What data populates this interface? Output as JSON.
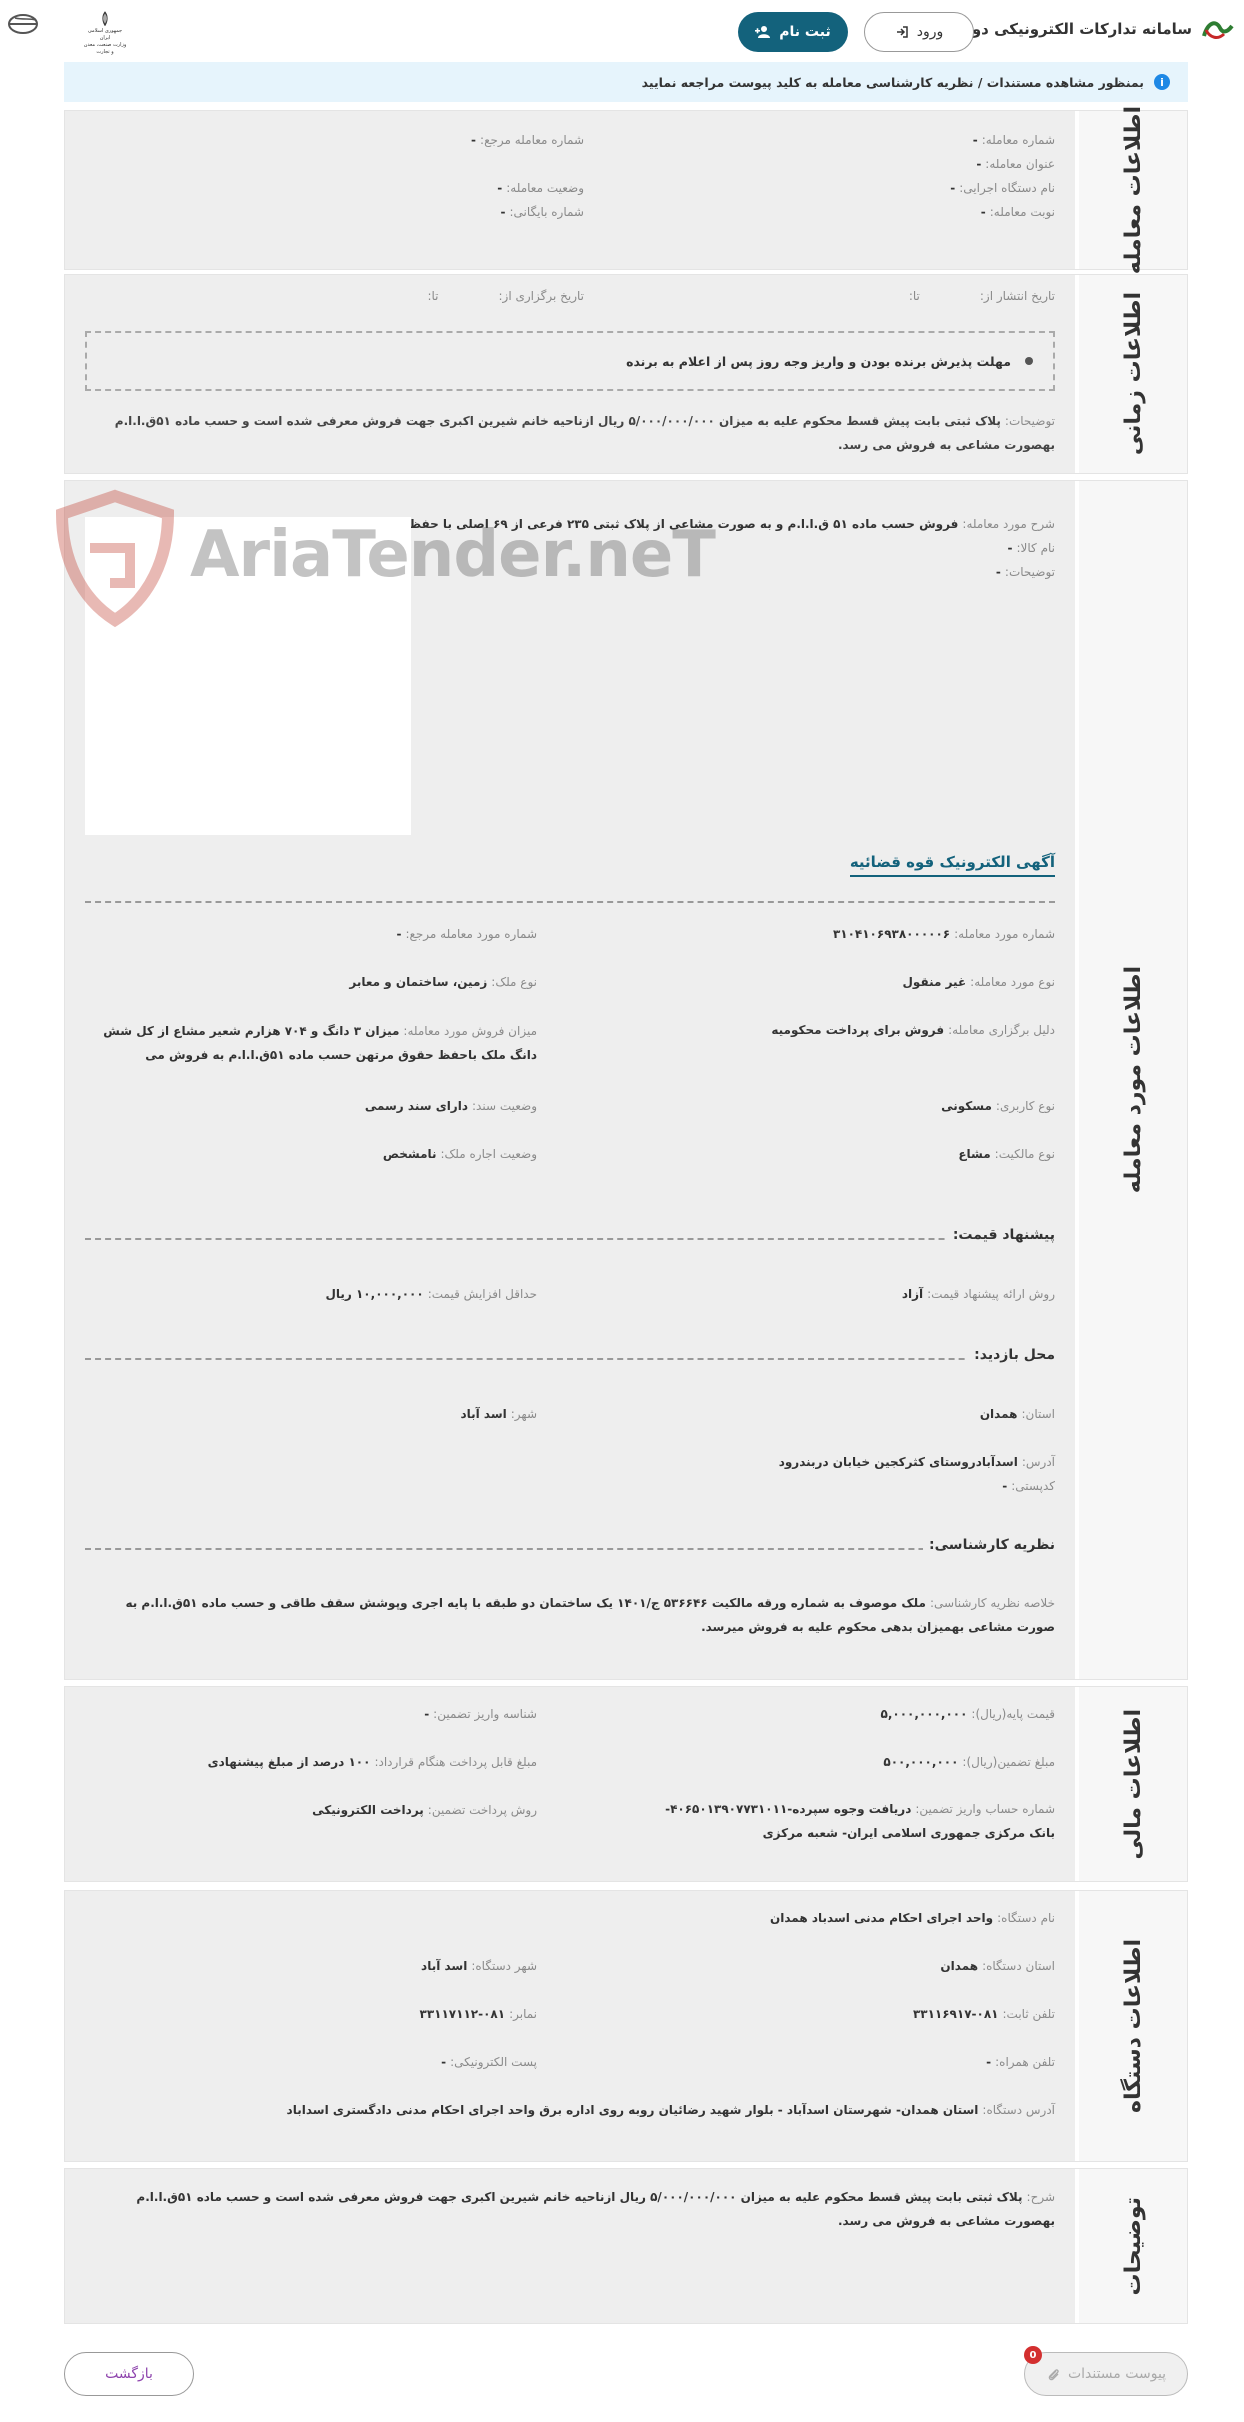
{
  "header": {
    "title": "سامانه تدارکات الکترونیکی دولت",
    "register_label": "ثبت نام",
    "login_label": "ورود",
    "gov_logo_text": "وزارت صنعت، معدن و تجارت",
    "gov_logo_subtext": "جمهوری اسلامی ایران"
  },
  "info_bar": {
    "text": "بمنظور مشاهده مستندات / نظریه کارشناسی معامله به کلید پیوست مراجعه نمایید"
  },
  "watermark": "AriaTender.neT",
  "deal_info": {
    "section_title": "اطلاعات معامله",
    "deal_number": {
      "label": "شماره معامله:",
      "value": "-"
    },
    "deal_title": {
      "label": "عنوان معامله:",
      "value": "-"
    },
    "agency_name": {
      "label": "نام دستگاه اجرایی:",
      "value": "-"
    },
    "deal_turn": {
      "label": "نوبت معامله:",
      "value": "-"
    },
    "ref_number": {
      "label": "شماره معامله مرجع:",
      "value": "-"
    },
    "deal_status": {
      "label": "وضعیت معامله:",
      "value": "-"
    },
    "archive_number": {
      "label": "شماره بایگانی:",
      "value": "-"
    }
  },
  "time_info": {
    "section_title": "اطلاعات زمانی",
    "publish_date": {
      "label": "تاریخ انتشار از:",
      "to": "تا:"
    },
    "hold_date": {
      "label": "تاریخ برگزاری از:",
      "to": "تا:"
    },
    "deadline": "مهلت پذیرش برنده بودن و واریز وجه روز پس از اعلام به برنده",
    "description": {
      "label": "توضیحات:",
      "value": "پلاک ثبتی بابت پیش قسط محکوم علیه به میزان ۵/۰۰۰/۰۰۰/۰۰۰ ریال ازناحیه خانم شیرین اکبری جهت فروش معرفی شده است و حسب ماده ۵۱ق.ا.ا.م بهصورت مشاعی به فروش می رسد."
    }
  },
  "item_info": {
    "section_title": "اطلاعات مورد معامله",
    "item_desc": {
      "label": "شرح مورد معامله:",
      "value": "فروش حسب ماده ۵۱ ق.ا.ا.م و به صورت مشاعی از پلاک ثبتی ۲۳۵ فرعی از ۶۹ اصلی با حفظ حقوق مرتهن"
    },
    "goods_name": {
      "label": "نام کالا:",
      "value": "-"
    },
    "notes": {
      "label": "توضیحات:",
      "value": "-"
    },
    "ad_link": "آگهی الکترونیک قوه قضائیه",
    "item_number": {
      "label": "شماره مورد معامله:",
      "value": "۳۱۰۴۱۰۶۹۳۸۰۰۰۰۰۶"
    },
    "item_ref_number": {
      "label": "شماره مورد معامله مرجع:",
      "value": "-"
    },
    "item_type": {
      "label": "نوع مورد معامله:",
      "value": "غیر منقول"
    },
    "property_type": {
      "label": "نوع ملک:",
      "value": "زمین، ساختمان و معابر"
    },
    "reason": {
      "label": "دلیل برگزاری معامله:",
      "value": "فروش برای پرداخت محکومیه"
    },
    "sale_amount": {
      "label": "میزان فروش مورد معامله:",
      "value": "میزان ۳ دانگ و ۷۰۴ هزارم شعیر مشاع از کل شش دانگ ملک باحفظ حقوق مرتهن حسب ماده ۵۱ق.ا.ا.م به فروش می"
    },
    "usage_type": {
      "label": "نوع کاربری:",
      "value": "مسکونی"
    },
    "deed_status": {
      "label": "وضعیت سند:",
      "value": "دارای سند رسمی"
    },
    "ownership_type": {
      "label": "نوع مالکیت:",
      "value": "مشاع"
    },
    "lease_status": {
      "label": "وضعیت اجاره ملک:",
      "value": "نامشخص"
    },
    "price_offer_heading": "پیشنهاد قیمت:",
    "offer_method": {
      "label": "روش ارائه پیشنهاد قیمت:",
      "value": "آزاد"
    },
    "min_increase": {
      "label": "حداقل افزایش قیمت:",
      "value": "۱۰,۰۰۰,۰۰۰ ریال"
    },
    "visit_heading": "محل بازدید:",
    "province": {
      "label": "استان:",
      "value": "همدان"
    },
    "city": {
      "label": "شهر:",
      "value": "اسد آباد"
    },
    "address": {
      "label": "آدرس:",
      "value": "اسدآبادروستای کثرکجین خیابان دربندرود"
    },
    "postal_code": {
      "label": "کدپستی:",
      "value": "-"
    },
    "expert_heading": "نظریه کارشناسی:",
    "expert_summary": {
      "label": "خلاصه نظریه کارشناسی:",
      "value": "ملک موصوف به شماره ورقه مالکیت ۵۳۶۶۴۶ ج/۱۴۰۱ یک ساختمان دو طبقه با پایه اجری وپوشش سقف طاقی و حسب ماده ۵۱ق.ا.ا.م به صورت مشاعی بهمیزان بدهی محکوم علیه به فروش میرسد."
    }
  },
  "financial_info": {
    "section_title": "اطلاعات مالی",
    "base_price": {
      "label": "قیمت پایه(ریال):",
      "value": "۵,۰۰۰,۰۰۰,۰۰۰"
    },
    "guarantee_deposit_id": {
      "label": "شناسه واریز تضمین:",
      "value": "-"
    },
    "guarantee_amount": {
      "label": "مبلغ تضمین(ریال):",
      "value": "۵۰۰,۰۰۰,۰۰۰"
    },
    "contract_payment": {
      "label": "مبلغ قابل پرداخت هنگام قرارداد:",
      "value": "۱۰۰ درصد از مبلغ پیشنهادی"
    },
    "account_number": {
      "label": "شماره حساب واریز تضمین:",
      "value": "دریافت وجوه سپرده-۴۰۶۵۰۱۳۹۰۷۷۳۱۰۱۱- بانک مرکزی جمهوری اسلامی ایران- شعبه مرکزی"
    },
    "payment_method": {
      "label": "روش پرداخت تضمین:",
      "value": "پرداخت الکترونیکی"
    }
  },
  "agency_info": {
    "section_title": "اطلاعات دستگاه",
    "agency_name": {
      "label": "نام دستگاه:",
      "value": "واحد اجرای احکام مدنی اسدباد همدان"
    },
    "agency_province": {
      "label": "استان دستگاه:",
      "value": "همدان"
    },
    "agency_city": {
      "label": "شهر دستگاه:",
      "value": "اسد آباد"
    },
    "phone": {
      "label": "تلفن ثابت:",
      "value": "۰۸۱-۳۳۱۱۶۹۱۷"
    },
    "fax": {
      "label": "نمابر:",
      "value": "۰۸۱-۳۳۱۱۷۱۱۲"
    },
    "mobile": {
      "label": "تلفن همراه:",
      "value": "-"
    },
    "email": {
      "label": "پست الکترونیکی:",
      "value": "-"
    },
    "address": {
      "label": "آدرس دستگاه:",
      "value": "استان همدان- شهرستان اسدآباد - بلوار شهید رضائیان روبه روی اداره برق واحد اجرای احکام مدنی دادگستری اسداباد"
    }
  },
  "notes_info": {
    "section_title": "توضیحات",
    "desc": {
      "label": "شرح:",
      "value": "پلاک ثبتی بابت پیش قسط محکوم علیه به میزان ۵/۰۰۰/۰۰۰/۰۰۰ ریال ازناحیه خانم شیرین اکبری جهت فروش معرفی شده است و حسب ماده ۵۱ق.ا.ا.م بهصورت مشاعی به فروش می رسد."
    }
  },
  "footer": {
    "back_label": "بازگشت",
    "attach_label": "پیوست مستندات",
    "attach_count": "0"
  }
}
